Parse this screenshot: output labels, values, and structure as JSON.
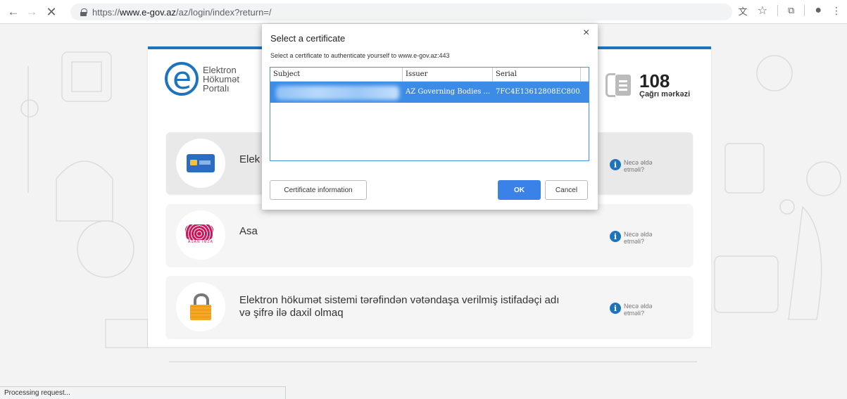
{
  "browser": {
    "url_scheme": "https://",
    "url_host": "www.e-gov.az",
    "url_path": "/az/login/index?return=/"
  },
  "site": {
    "logo_lines": [
      "Elektron",
      "Hökumət",
      "Portalı"
    ],
    "call_number": "108",
    "call_label": "Çağrı mərkəzi",
    "options": [
      {
        "text": "Elek",
        "help": [
          "Necə əldə",
          "etməli?"
        ]
      },
      {
        "text": "Asa",
        "help": [
          "Necə əldə",
          "etməli?"
        ]
      },
      {
        "text_line1": "Elektron hökumət sistemi tərəfindən vətəndaşa verilmiş istifadəçi adı",
        "text_line2": "və şifrə ilə daxil olmaq",
        "help": [
          "Necə əldə",
          "etməli?"
        ]
      }
    ]
  },
  "dialog": {
    "title": "Select a certificate",
    "subtitle": "Select a certificate to authenticate yourself to www.e-gov.az:443",
    "columns": [
      "Subject",
      "Issuer",
      "Serial"
    ],
    "rows": [
      {
        "subject": "",
        "issuer": "AZ Governing Bodies ...",
        "serial": "7FC4E13612808EC800..."
      }
    ],
    "btn_info": "Certificate information",
    "btn_ok": "OK",
    "btn_cancel": "Cancel",
    "close_glyph": "×"
  },
  "status": {
    "text": "Processing request..."
  }
}
